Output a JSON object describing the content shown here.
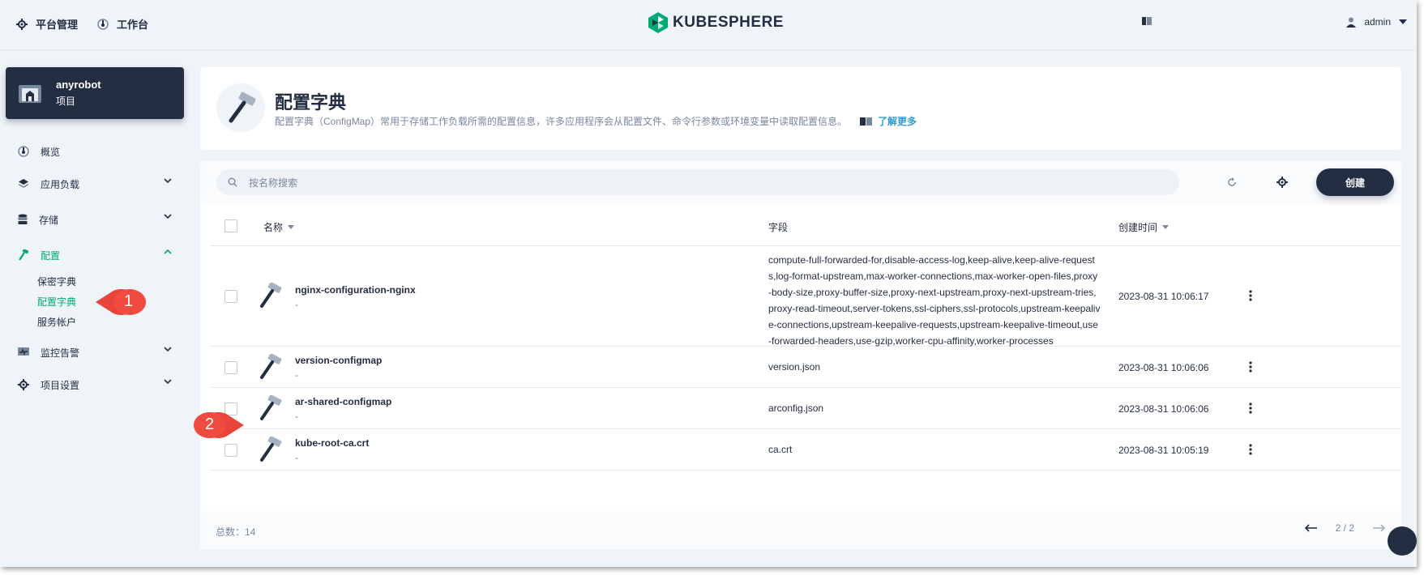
{
  "topbar": {
    "platform_label": "平台管理",
    "workbench_label": "工作台",
    "logo_text": "KUBESPHERE",
    "user_name": "admin"
  },
  "project": {
    "name": "anyrobot",
    "type": "项目"
  },
  "sidebar": {
    "items": [
      {
        "label": "概览",
        "icon": "dashboard-icon"
      },
      {
        "label": "应用负载",
        "icon": "layers-icon"
      },
      {
        "label": "存储",
        "icon": "database-icon"
      },
      {
        "label": "配置",
        "icon": "hammer-icon"
      },
      {
        "label": "监控告警",
        "icon": "monitor-icon"
      },
      {
        "label": "项目设置",
        "icon": "gear-icon"
      }
    ],
    "config_sub": [
      "保密字典",
      "配置字典",
      "服务帐户"
    ],
    "active_item": "配置",
    "active_sub": "配置字典"
  },
  "header": {
    "title": "配置字典",
    "description": "配置字典（ConfigMap）常用于存储工作负载所需的配置信息，许多应用程序会从配置文件、命令行参数或环境变量中读取配置信息。",
    "learn_more": "了解更多"
  },
  "toolbar": {
    "search_placeholder": "按名称搜索",
    "create_label": "创建"
  },
  "table": {
    "headers": {
      "name": "名称",
      "field": "字段",
      "created": "创建时间"
    },
    "rows": [
      {
        "name": "nginx-configuration-nginx",
        "desc": "-",
        "field": "compute-full-forwarded-for,disable-access-log,keep-alive,keep-alive-requests,log-format-upstream,max-worker-connections,max-worker-open-files,proxy-body-size,proxy-buffer-size,proxy-next-upstream,proxy-next-upstream-tries,proxy-read-timeout,server-tokens,ssl-ciphers,ssl-protocols,upstream-keepalive-connections,upstream-keepalive-requests,upstream-keepalive-timeout,use-forwarded-headers,use-gzip,worker-cpu-affinity,worker-processes",
        "created": "2023-08-31 10:06:17"
      },
      {
        "name": "version-configmap",
        "desc": "-",
        "field": "version.json",
        "created": "2023-08-31 10:06:06"
      },
      {
        "name": "ar-shared-configmap",
        "desc": "-",
        "field": "arconfig.json",
        "created": "2023-08-31 10:06:06"
      },
      {
        "name": "kube-root-ca.crt",
        "desc": "-",
        "field": "ca.crt",
        "created": "2023-08-31 10:05:19"
      }
    ]
  },
  "footer": {
    "total": "总数：14",
    "page": "2 / 2"
  },
  "callouts": [
    "1",
    "2"
  ],
  "colors": {
    "accent_green": "#00aa72",
    "dark": "#242e42",
    "callout_red": "#e8443a",
    "background": "#eff4f9"
  }
}
